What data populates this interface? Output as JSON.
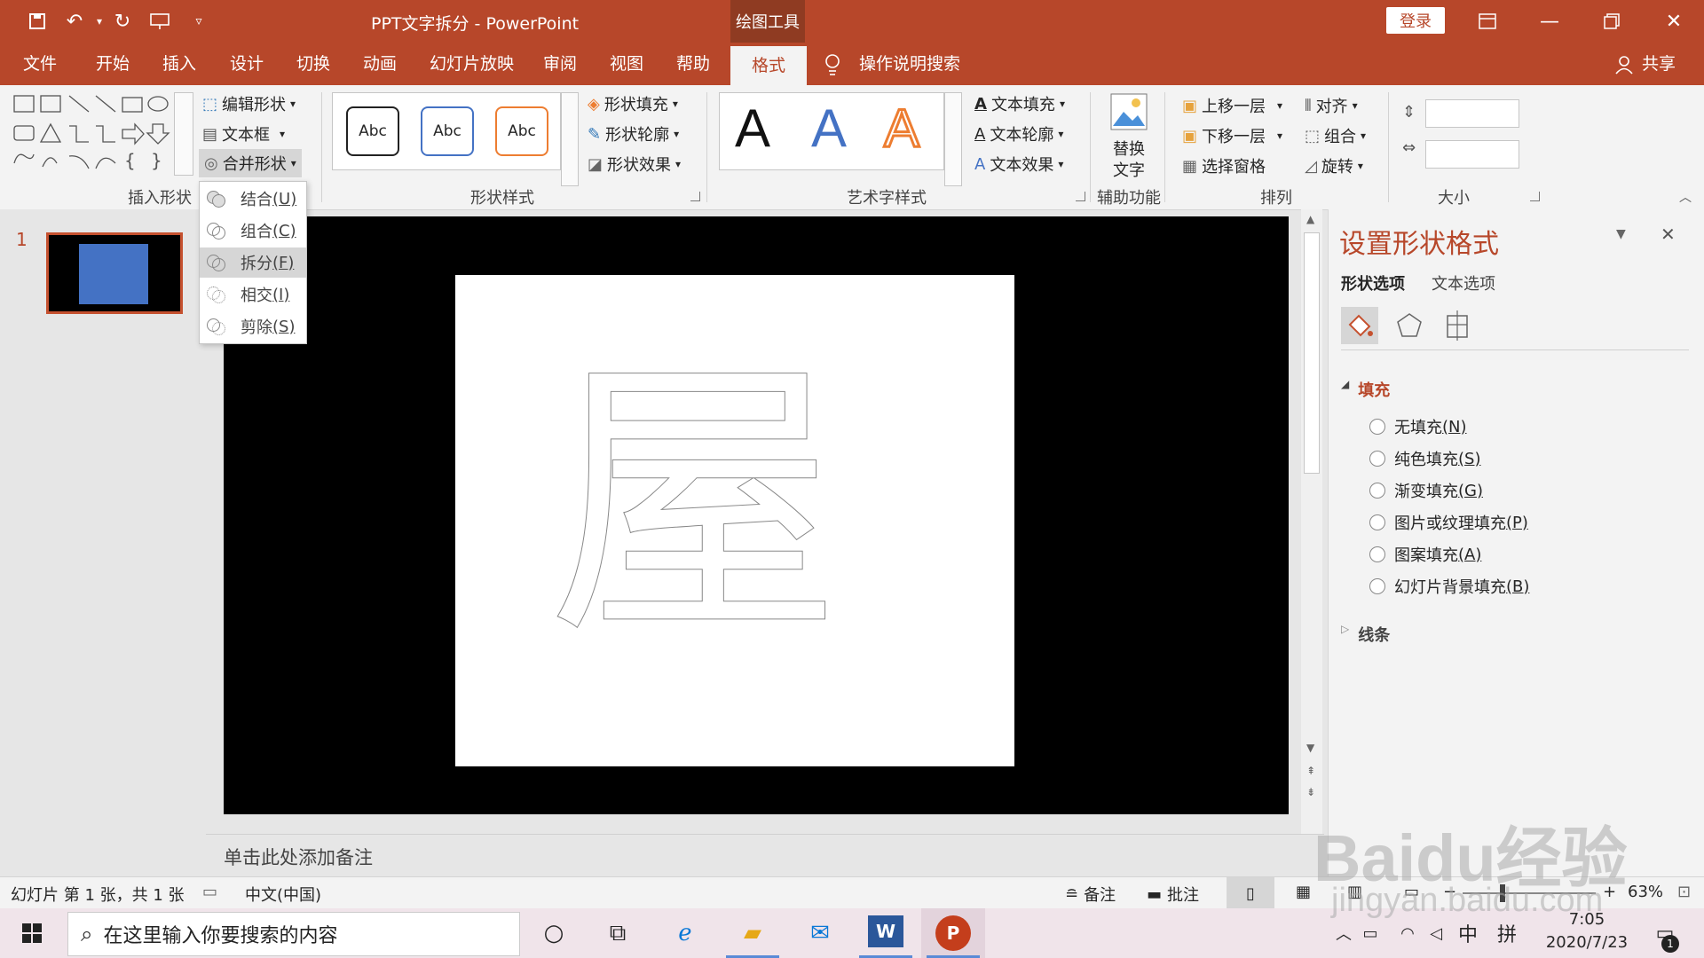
{
  "window": {
    "doc_title": "PPT文字拆分  -  PowerPoint",
    "tool_context": "绘图工具",
    "login": "登录",
    "share": "共享"
  },
  "tabs": [
    "文件",
    "开始",
    "插入",
    "设计",
    "切换",
    "动画",
    "幻灯片放映",
    "审阅",
    "视图",
    "帮助"
  ],
  "active_tab": "格式",
  "tell_me": "操作说明搜索",
  "ribbon": {
    "insert_shapes": {
      "edit_shape": "编辑形状",
      "textbox": "文本框",
      "merge_shapes": "合并形状",
      "label": "插入形状"
    },
    "shape_styles": {
      "thumbs": [
        "Abc",
        "Abc",
        "Abc"
      ],
      "fill": "形状填充",
      "outline": "形状轮廓",
      "effect": "形状效果",
      "label": "形状样式"
    },
    "wordart": {
      "letters": [
        "A",
        "A",
        "A"
      ],
      "text_fill": "文本填充",
      "text_outline": "文本轮廓",
      "text_effect": "文本效果",
      "label": "艺术字样式"
    },
    "accessibility": {
      "alt_text_1": "替换",
      "alt_text_2": "文字",
      "label": "辅助功能"
    },
    "arrange": {
      "bring_forward": "上移一层",
      "send_backward": "下移一层",
      "selection_pane": "选择窗格",
      "align": "对齐",
      "group": "组合",
      "rotate": "旋转",
      "label": "排列"
    },
    "size": {
      "label": "大小"
    }
  },
  "merge_menu": [
    {
      "label": "结合",
      "key": "(U)"
    },
    {
      "label": "组合",
      "key": "(C)"
    },
    {
      "label": "拆分",
      "key": "(F)"
    },
    {
      "label": "相交",
      "key": "(I)"
    },
    {
      "label": "剪除",
      "key": "(S)"
    }
  ],
  "thumb_number": "1",
  "slide_char": "屋",
  "notes_placeholder": "单击此处添加备注",
  "format_pane": {
    "title": "设置形状格式",
    "tab_shape": "形状选项",
    "tab_text": "文本选项",
    "fill_header": "填充",
    "fill_options": [
      {
        "label": "无填充",
        "key": "(N)"
      },
      {
        "label": "纯色填充",
        "key": "(S)"
      },
      {
        "label": "渐变填充",
        "key": "(G)"
      },
      {
        "label": "图片或纹理填充",
        "key": "(P)"
      },
      {
        "label": "图案填充",
        "key": "(A)"
      },
      {
        "label": "幻灯片背景填充",
        "key": "(B)"
      }
    ],
    "line_header": "线条"
  },
  "status": {
    "slide_info": "幻灯片 第 1 张，共 1 张",
    "language": "中文(中国)",
    "notes": "备注",
    "comments": "批注",
    "zoom": "63%"
  },
  "taskbar": {
    "search_placeholder": "在这里输入你要搜索的内容",
    "ime_mode": "中",
    "ime_pinyin": "拼",
    "time": "7:05",
    "date": "2020/7/23",
    "notif_count": "1"
  },
  "watermark": {
    "line1": "Baidu经验",
    "line2": "jingyan.baidu.com"
  },
  "colors": {
    "accent": "#b7472a",
    "slide_shape": "#4472c4"
  }
}
